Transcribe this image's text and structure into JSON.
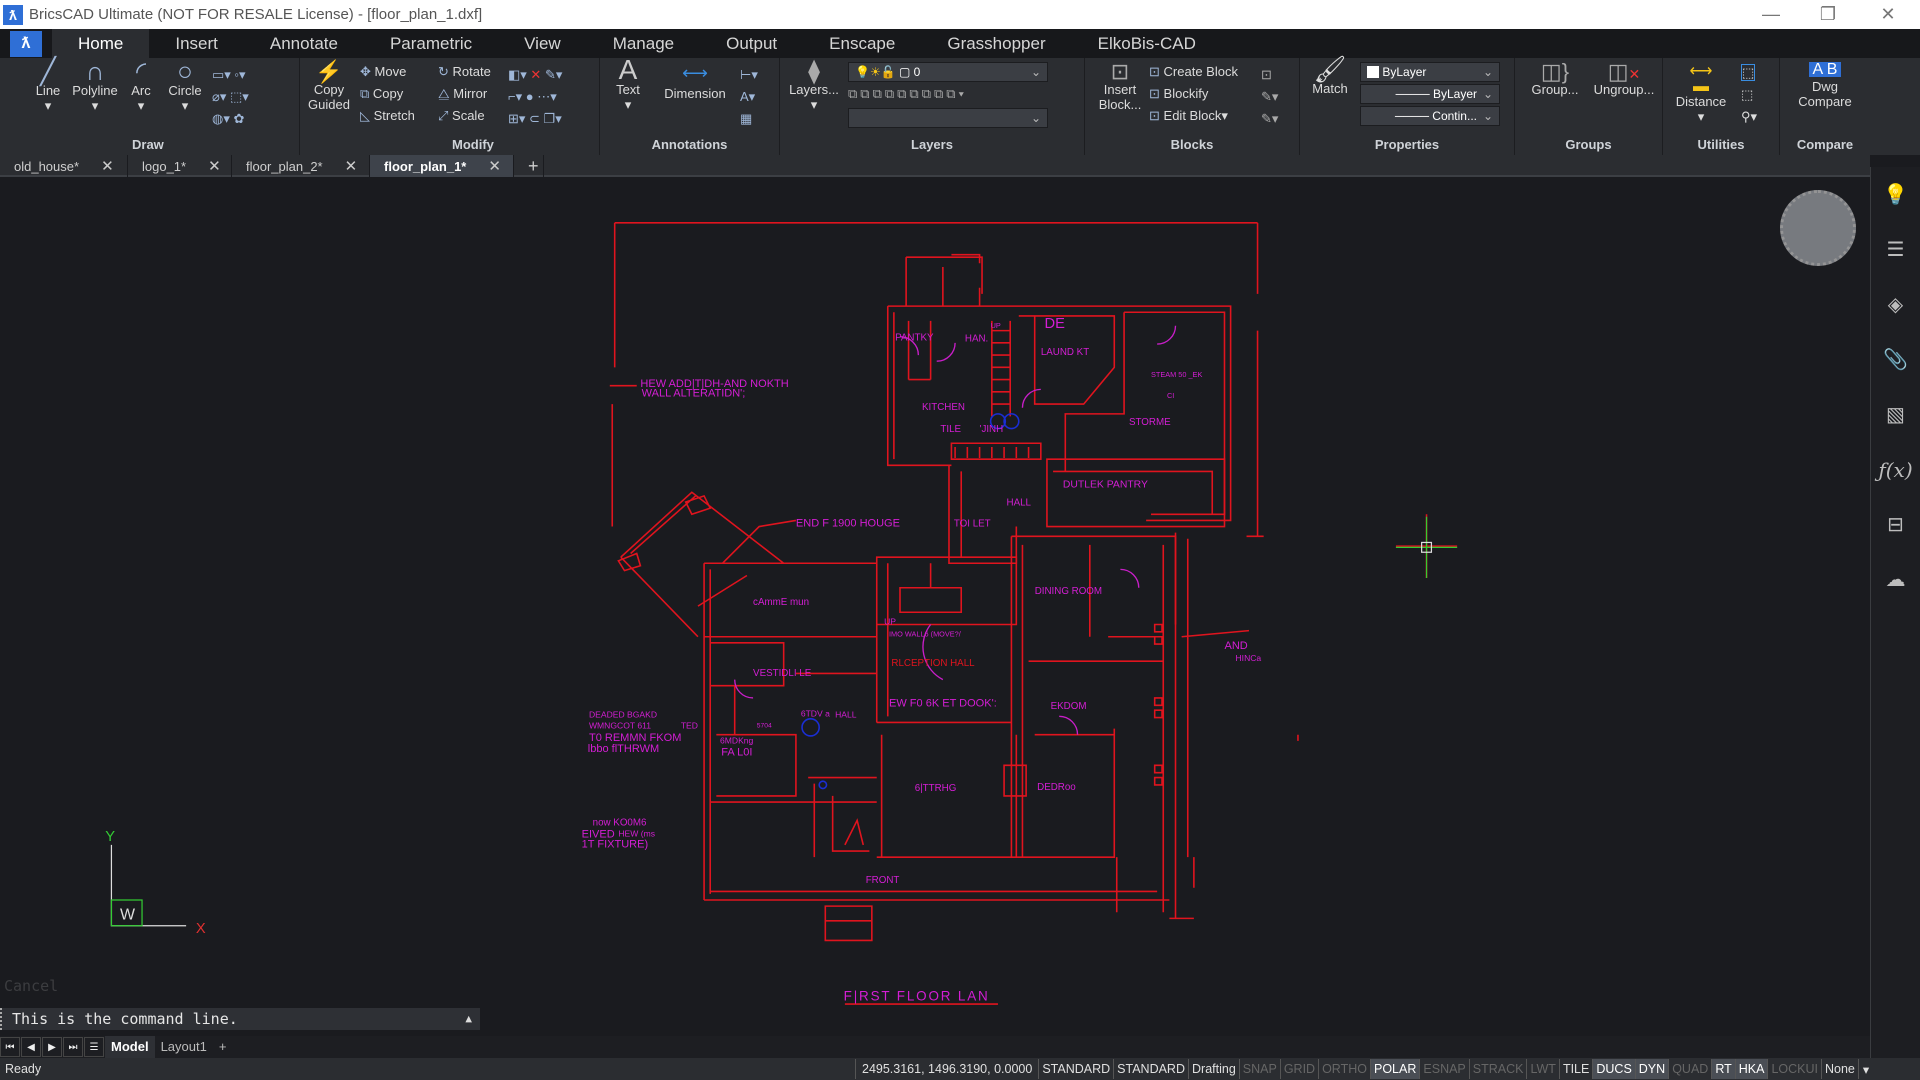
{
  "window": {
    "title": "BricsCAD Ultimate (NOT FOR RESALE License) - [floor_plan_1.dxf]",
    "controls": [
      "minimize",
      "restore",
      "close"
    ]
  },
  "menu": {
    "tabs": [
      "Home",
      "Insert",
      "Annotate",
      "Parametric",
      "View",
      "Manage",
      "Output",
      "Enscape",
      "Grasshopper",
      "ElkoBis-CAD"
    ],
    "active": "Home"
  },
  "ribbon": {
    "draw": {
      "label": "Draw",
      "tools": [
        "Line",
        "Polyline",
        "Arc",
        "Circle"
      ]
    },
    "modify": {
      "label": "Modify",
      "copy_guided": "Copy Guided",
      "tools": [
        "Move",
        "Copy",
        "Stretch",
        "Rotate",
        "Mirror",
        "Scale"
      ]
    },
    "annotations": {
      "label": "Annotations",
      "tools": [
        "Text",
        "Dimension"
      ]
    },
    "layers": {
      "label": "Layers",
      "button": "Layers...",
      "current_layer": "0",
      "layer_state": ""
    },
    "blocks": {
      "label": "Blocks",
      "insert": "Insert Block...",
      "tools": [
        "Create Block",
        "Blockify",
        "Edit Block"
      ]
    },
    "properties": {
      "label": "Properties",
      "match": "Match",
      "color": "ByLayer",
      "lineweight": "ByLayer",
      "linetype": "Contin..."
    },
    "groups": {
      "label": "Groups",
      "tools": [
        "Group...",
        "Ungroup..."
      ]
    },
    "utilities": {
      "label": "Utilities",
      "tools": [
        "Distance"
      ]
    },
    "compare": {
      "label": "Compare",
      "tools": [
        "Dwg Compare"
      ]
    }
  },
  "doc_tabs": [
    {
      "label": "old_house*"
    },
    {
      "label": "logo_1*"
    },
    {
      "label": "floor_plan_2*"
    },
    {
      "label": "floor_plan_1*",
      "active": true
    }
  ],
  "drawing": {
    "labels": {
      "addition": "HEW ADD|T|DH-AND NOKTH",
      "addition2": "WALL ALTERATIDN';",
      "end1900": "END  F  1900 HOUGE",
      "pantry": "PANTKY",
      "han": "HAN.",
      "up": "UP",
      "de": "DE",
      "laundry": "LAUND KT",
      "kitchen": "KITCHEN",
      "tile": "TILE",
      "jinh": "'JINH",
      "steam": "STEAM  50 _EK",
      "ci": "CI",
      "storme": "STORME",
      "outlet_pantry": "DUTLEK  PANTRY",
      "hall": "HALL",
      "toilet": "TOI LET",
      "camme": "cAmmE   mun",
      "dining": "DINING ROOM",
      "up2": "UP",
      "mowalls": "IMO WALL6 (MOVE?/",
      "reception": "RLCEPTION HALL",
      "vestibule": "VESTIDLI LE",
      "stdv": "6TDV a",
      "hall2": "HALL",
      "s5704": "5704",
      "smoking": "6MDKng",
      "fal": "FA  L0I",
      "newfork": "EW  F0 6K ET  DOOK':",
      "bedroom": "EKDOM",
      "sitting": "6|TTRHG",
      "bedroom2": "DEDRoo",
      "and": "AND",
      "hinca": "HINCa",
      "front": "FRONT",
      "deaded1": "DEADED   BGAKD",
      "deaded2": "WMNGCOT 611",
      "deaded3": "T0  REMMN  FKOM",
      "deaded4": "lbbo  flTHRWM",
      "ted": "TED",
      "now1": "now   KO0M6",
      "now2": "EIVED",
      "now3": "HEW (ms",
      "now4": "1T FIXTURE)",
      "title": "F|RST FLOOR  LAN"
    },
    "ucs": {
      "x": "X",
      "y": "Y",
      "w": "W"
    },
    "colors": {
      "walls": "#e0141e",
      "text": "#d41ed4",
      "fixtures": "#1a2ed4",
      "background": "#1a1b1f"
    }
  },
  "command": {
    "history": "Cancel",
    "prompt": "This is the command line."
  },
  "layout_tabs": {
    "tabs": [
      "Model",
      "Layout1"
    ],
    "active": "Model",
    "add": "+"
  },
  "status": {
    "ready": "Ready",
    "coords": "2495.3161, 1496.3190, 0.0000",
    "toggles": [
      {
        "label": "STANDARD",
        "state": "text"
      },
      {
        "label": "STANDARD",
        "state": "text"
      },
      {
        "label": "Drafting",
        "state": "text"
      },
      {
        "label": "SNAP",
        "state": "off"
      },
      {
        "label": "GRID",
        "state": "off"
      },
      {
        "label": "ORTHO",
        "state": "off"
      },
      {
        "label": "POLAR",
        "state": "on"
      },
      {
        "label": "ESNAP",
        "state": "off"
      },
      {
        "label": "STRACK",
        "state": "off"
      },
      {
        "label": "LWT",
        "state": "off"
      },
      {
        "label": "TILE",
        "state": "text"
      },
      {
        "label": "DUCS",
        "state": "on"
      },
      {
        "label": "DYN",
        "state": "on"
      },
      {
        "label": "QUAD",
        "state": "off"
      },
      {
        "label": "RT",
        "state": "on"
      },
      {
        "label": "HKA",
        "state": "on"
      },
      {
        "label": "LOCKUI",
        "state": "off"
      },
      {
        "label": "None",
        "state": "text"
      }
    ]
  },
  "sidebar": {
    "icons": [
      "lightbulb-icon",
      "sliders-icon",
      "layers-icon",
      "paperclip-icon",
      "hatch-icon",
      "fx-icon",
      "tree-icon",
      "cloud-upload-icon"
    ]
  }
}
